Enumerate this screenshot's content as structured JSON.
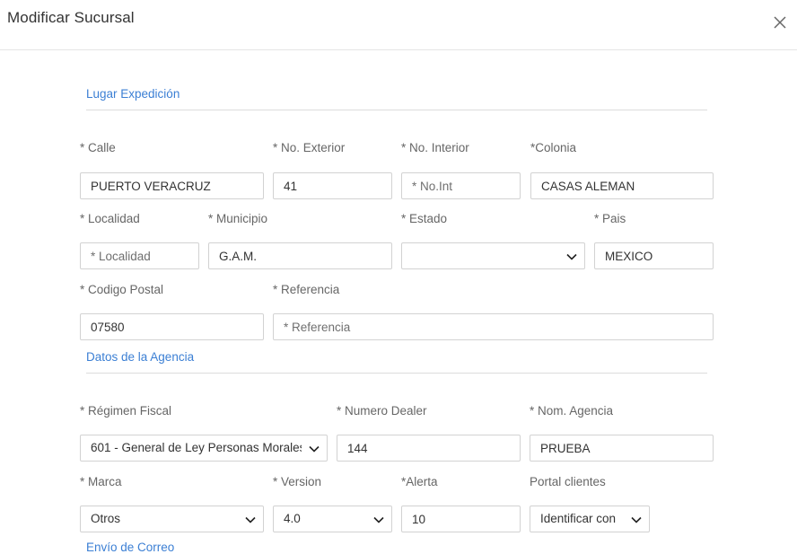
{
  "modal": {
    "title": "Modificar Sucursal"
  },
  "sections": {
    "lugar": "Lugar Expedición",
    "agencia": "Datos de la Agencia",
    "correo": "Envío de Correo"
  },
  "fields": {
    "calle": {
      "label": "* Calle",
      "value": "PUERTO VERACRUZ"
    },
    "no_exterior": {
      "label": "* No. Exterior",
      "value": "41"
    },
    "no_interior": {
      "label": "* No. Interior",
      "placeholder": "* No.Int"
    },
    "colonia": {
      "label": "*Colonia",
      "value": "CASAS ALEMAN"
    },
    "localidad": {
      "label": "* Localidad",
      "placeholder": "* Localidad"
    },
    "municipio": {
      "label": "* Municipio",
      "value": "G.A.M."
    },
    "estado": {
      "label": "* Estado",
      "value": ""
    },
    "pais": {
      "label": "* Pais",
      "value": "MEXICO"
    },
    "codigo_postal": {
      "label": "* Codigo Postal",
      "value": "07580"
    },
    "referencia": {
      "label": "* Referencia",
      "placeholder": "* Referencia"
    },
    "regimen_fiscal": {
      "label": "* Régimen Fiscal",
      "value": "601 - General de Ley Personas Morales"
    },
    "numero_dealer": {
      "label": "* Numero Dealer",
      "value": "144"
    },
    "nom_agencia": {
      "label": "* Nom. Agencia",
      "value": "PRUEBA"
    },
    "marca": {
      "label": "* Marca",
      "value": "Otros"
    },
    "version": {
      "label": "* Version",
      "value": "4.0"
    },
    "alerta": {
      "label": "*Alerta",
      "value": "10"
    },
    "portal_clientes": {
      "label": "Portal clientes",
      "value": "Identificar con"
    }
  },
  "colors": {
    "accent": "#3b7fd4",
    "border": "#d2d2d2",
    "label": "#666666"
  },
  "icons": {
    "close": "close-icon",
    "dropdown": "chevron-down-icon"
  }
}
